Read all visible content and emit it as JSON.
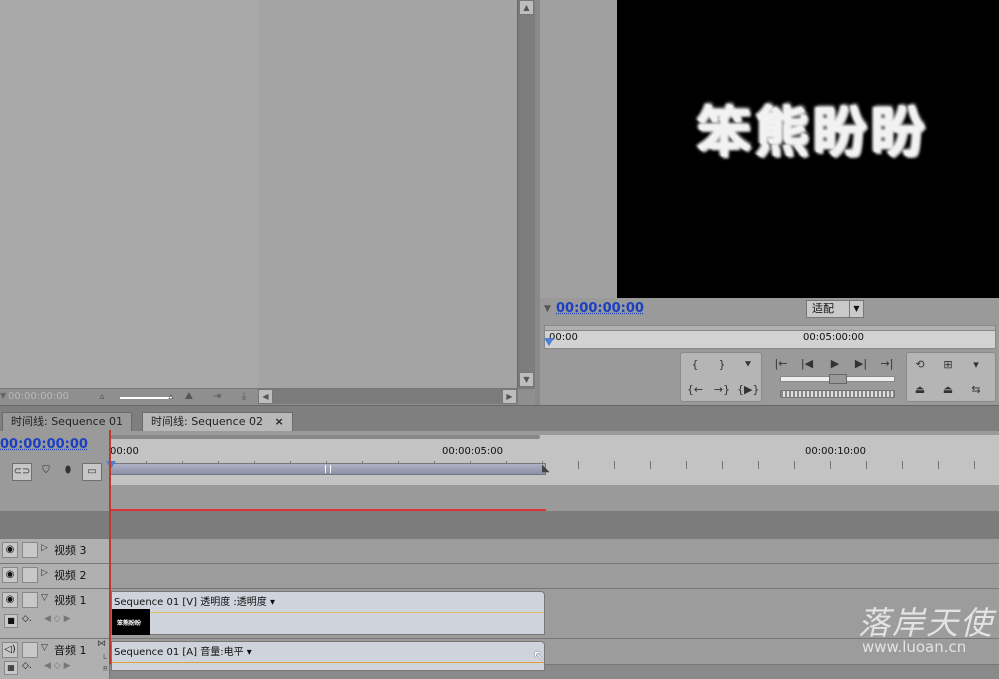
{
  "source_monitor": {
    "timecode": "00:00:00:00",
    "icons": [
      "scroll-up-icon",
      "scroll-down-icon",
      "scroll-left-icon",
      "scroll-right-icon",
      "zoom-out-icon",
      "zoom-in-icon",
      "insert-icon",
      "overlay-icon"
    ]
  },
  "program_monitor": {
    "preview_text": "笨熊盼盼",
    "timecode": "00:00:00:00",
    "fit_label": "适配",
    "ruler_start": "00:00",
    "ruler_mid": "00:05:00:00",
    "controls": {
      "mark_in": "{",
      "mark_out": "}",
      "set_marker": "⯆",
      "go_in": "{←",
      "go_out": "→}",
      "play_in_out": "{▶}",
      "step_back": "|◀",
      "play": "▶",
      "step_fwd": "▶|",
      "go_prev_edit": "|←",
      "go_next_edit": "→|",
      "loop": "⟲",
      "safe_margins": "⊞",
      "output": "▾",
      "lift": "⏏",
      "extract": "⏏",
      "trim": "⇆"
    }
  },
  "timeline": {
    "tabs": [
      {
        "label": "时间线: Sequence 01",
        "active": false
      },
      {
        "label": "时间线: Sequence 02",
        "active": true,
        "close": "×"
      }
    ],
    "timecode": "00:00:00:00",
    "ruler_labels": [
      "00:00",
      "00:00:05:00",
      "00:00:10:00"
    ],
    "tracks": [
      {
        "name": "视频 3",
        "type": "video",
        "expanded": false
      },
      {
        "name": "视频 2",
        "type": "video",
        "expanded": false
      },
      {
        "name": "视频 1",
        "type": "video",
        "expanded": true,
        "clip": "Sequence 01 [V]  透明度 :透明度 ▾"
      },
      {
        "name": "音频 1",
        "type": "audio",
        "expanded": true,
        "clip": "Sequence 01 [A]  音量:电平 ▾"
      }
    ],
    "audio_channel_labels": [
      "L",
      "R"
    ],
    "thumb_text": "笨熊盼盼"
  },
  "watermark": {
    "name": "落岸天使",
    "url": "www.luoan.cn"
  },
  "colors": {
    "timecode": "#1a3fc4",
    "playhead": "#c0392b",
    "screen_bg": "#000000"
  }
}
